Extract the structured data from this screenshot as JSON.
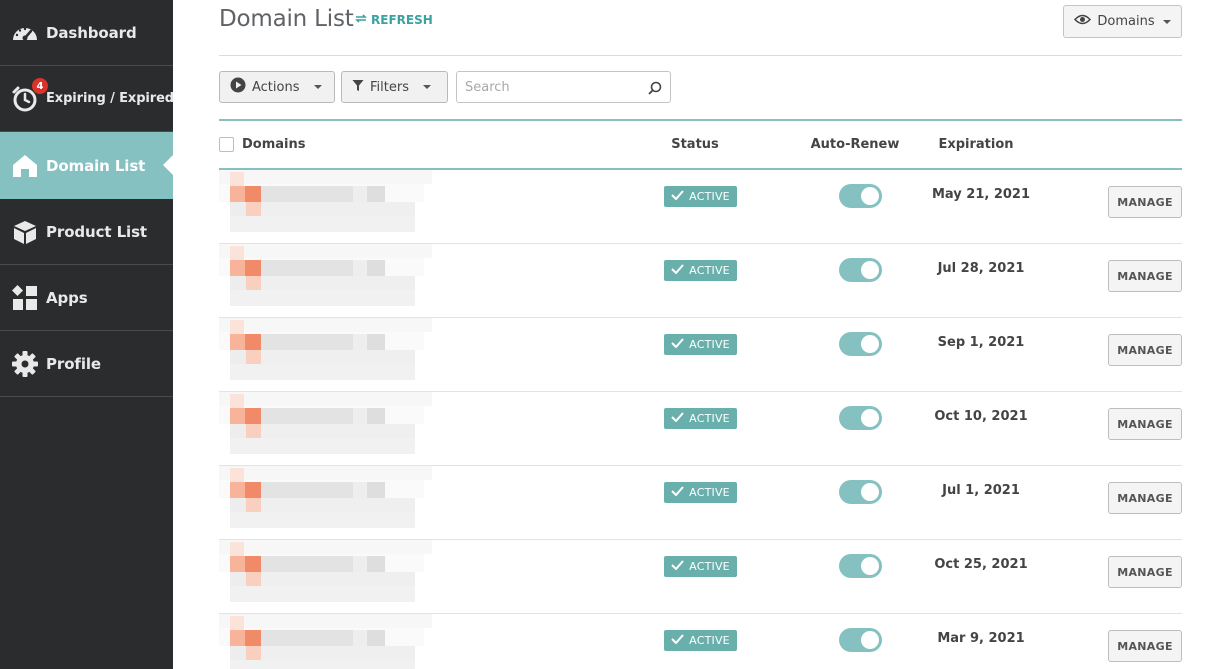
{
  "sidebar": {
    "items": [
      {
        "label": "Dashboard",
        "icon": "speedometer-icon"
      },
      {
        "label": "Expiring / Expired",
        "icon": "alarm-clock-icon",
        "badge": "4"
      },
      {
        "label": "Domain List",
        "icon": "house-icon",
        "active": true
      },
      {
        "label": "Product List",
        "icon": "box-icon"
      },
      {
        "label": "Apps",
        "icon": "apps-grid-icon"
      },
      {
        "label": "Profile",
        "icon": "gear-icon"
      }
    ]
  },
  "header": {
    "title": "Domain List",
    "refresh_label": "REFRESH",
    "view_dropdown": "Domains"
  },
  "toolbar": {
    "actions_label": "Actions",
    "filters_label": "Filters",
    "search_placeholder": "Search"
  },
  "table": {
    "columns": [
      "Domains",
      "Status",
      "Auto-Renew",
      "Expiration"
    ],
    "manage_label": "MANAGE",
    "rows": [
      {
        "status": "ACTIVE",
        "auto_renew": true,
        "expiration": "May 21, 2021"
      },
      {
        "status": "ACTIVE",
        "auto_renew": true,
        "expiration": "Jul 28, 2021"
      },
      {
        "status": "ACTIVE",
        "auto_renew": true,
        "expiration": "Sep 1, 2021"
      },
      {
        "status": "ACTIVE",
        "auto_renew": true,
        "expiration": "Oct 10, 2021"
      },
      {
        "status": "ACTIVE",
        "auto_renew": true,
        "expiration": "Jul 1, 2021"
      },
      {
        "status": "ACTIVE",
        "auto_renew": true,
        "expiration": "Oct 25, 2021"
      },
      {
        "status": "ACTIVE",
        "auto_renew": true,
        "expiration": "Mar 9, 2021"
      }
    ]
  },
  "colors": {
    "sidebar_bg": "#2b2c2e",
    "accent": "#84c1c0",
    "status_active": "#69b0ad",
    "badge": "#d9342b",
    "refresh": "#3aa3a1"
  }
}
